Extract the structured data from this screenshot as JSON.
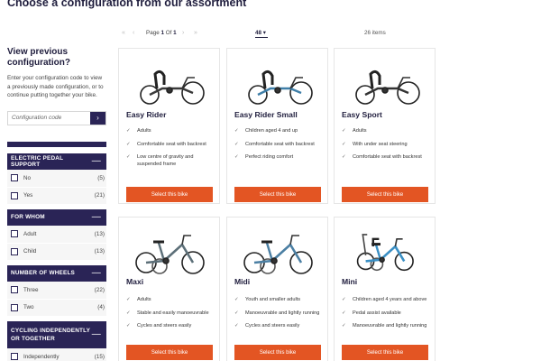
{
  "page": {
    "title": "Choose a configuration from our assortment"
  },
  "sidebar": {
    "heading": "View previous configuration?",
    "description": "Enter your configuration code to view a previously made configuration, or to continue putting together your bike.",
    "code_placeholder": "Configuration code",
    "code_button": "›",
    "filters": [
      {
        "title": "ELECTRIC PEDAL SUPPORT",
        "toggle": "—",
        "options": [
          {
            "label": "No",
            "count": "(5)"
          },
          {
            "label": "Yes",
            "count": "(21)"
          }
        ]
      },
      {
        "title": "FOR WHOM",
        "toggle": "—",
        "options": [
          {
            "label": "Adult",
            "count": "(13)"
          },
          {
            "label": "Child",
            "count": "(13)"
          }
        ]
      },
      {
        "title": "NUMBER OF WHEELS",
        "toggle": "—",
        "options": [
          {
            "label": "Three",
            "count": "(22)"
          },
          {
            "label": "Two",
            "count": "(4)"
          }
        ]
      },
      {
        "title": "CYCLING INDEPENDENTLY OR TOGETHER",
        "toggle": "—",
        "options": [
          {
            "label": "Independently",
            "count": "(15)"
          }
        ]
      }
    ]
  },
  "pagination": {
    "first": "«",
    "prev": "‹",
    "next": "›",
    "last": "»",
    "page_label": "Page",
    "current": "1",
    "of_label": "Of",
    "total": "1",
    "per_page": "48",
    "per_page_arrow": "▾",
    "items": "26 items"
  },
  "check_glyph": "✓",
  "products": [
    {
      "name": "Easy Rider",
      "features": [
        "Adults",
        "Comfortable seat with backrest",
        "Low centre of gravity and suspended frame"
      ],
      "button": "Select this bike",
      "frame_color": "#3a3a3a",
      "style": "recumbent"
    },
    {
      "name": "Easy Rider Small",
      "features": [
        "Children aged 4 and up",
        "Comfortable seat with backrest",
        "Perfect riding comfort"
      ],
      "button": "Select this bike",
      "frame_color": "#3f7fa8",
      "style": "recumbent"
    },
    {
      "name": "Easy Sport",
      "features": [
        "Adults",
        "With under seat steering",
        "Comfortable seat with backrest"
      ],
      "button": "Select this bike",
      "frame_color": "#333333",
      "style": "recumbent"
    },
    {
      "name": "Maxi",
      "features": [
        "Adults",
        "Stable and easily manoeuvrable",
        "Cycles and steers easily"
      ],
      "button": "Select this bike",
      "frame_color": "#5c6f78",
      "style": "trike"
    },
    {
      "name": "Midi",
      "features": [
        "Youth and smaller adults",
        "Manoeuvrable and lightly running",
        "Cycles and steers easily"
      ],
      "button": "Select this bike",
      "frame_color": "#4b7fa3",
      "style": "trike"
    },
    {
      "name": "Mini",
      "features": [
        "Children aged 4 years and above",
        "Pedal assist available",
        "Manoeuvrable and lightly running"
      ],
      "button": "Select this bike",
      "frame_color": "#3a8fc4",
      "style": "trike-child"
    }
  ]
}
